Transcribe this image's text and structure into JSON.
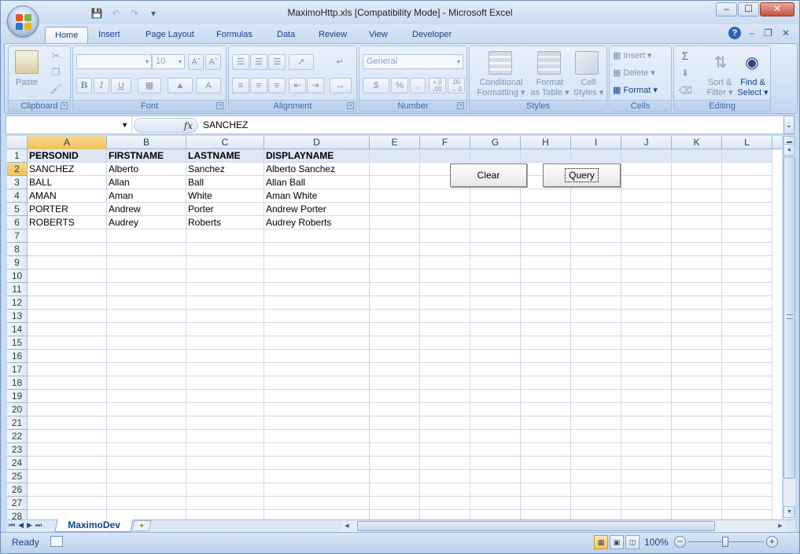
{
  "window": {
    "title": "MaximoHttp.xls  [Compatibility Mode] - Microsoft Excel",
    "min": "–",
    "max": "☐",
    "close": "✕"
  },
  "tabs": [
    "Home",
    "Insert",
    "Page Layout",
    "Formulas",
    "Data",
    "Review",
    "View",
    "Developer"
  ],
  "active_tab": "Home",
  "ribbon": {
    "clipboard": {
      "label": "Clipboard",
      "paste": "Paste"
    },
    "font": {
      "label": "Font",
      "font_name": "",
      "font_size": "10"
    },
    "alignment": {
      "label": "Alignment"
    },
    "number": {
      "label": "Number",
      "format": "General",
      "currency": "$",
      "percent": "%",
      "comma": ",",
      "inc_dec": "+.0\n.00",
      "dec_dec": ".00\n→.0"
    },
    "styles": {
      "label": "Styles",
      "conditional": [
        "Conditional",
        "Formatting ▾"
      ],
      "format_table": [
        "Format",
        "as Table ▾"
      ],
      "cell_styles": [
        "Cell",
        "Styles ▾"
      ]
    },
    "cells": {
      "label": "Cells",
      "insert": "Insert ▾",
      "delete": "Delete ▾",
      "format": "Format ▾"
    },
    "editing": {
      "label": "Editing",
      "sort": [
        "Sort &",
        "Filter ▾"
      ],
      "find": [
        "Find &",
        "Select ▾"
      ]
    }
  },
  "formula_bar": {
    "name_box": "",
    "fx": "fx",
    "content": "SANCHEZ"
  },
  "columns": [
    "A",
    "B",
    "C",
    "D",
    "E",
    "F",
    "G",
    "H",
    "I",
    "J",
    "K",
    "L"
  ],
  "rows": [
    "1",
    "2",
    "3",
    "4",
    "5",
    "6",
    "7",
    "8",
    "9",
    "10",
    "11",
    "12",
    "13",
    "14",
    "15",
    "16",
    "17",
    "18",
    "19",
    "20",
    "21",
    "22",
    "23",
    "24",
    "25",
    "26",
    "27",
    "28"
  ],
  "table": {
    "headers": [
      "PERSONID",
      "FIRSTNAME",
      "LASTNAME",
      "DISPLAYNAME"
    ],
    "data": [
      [
        "SANCHEZ",
        "Alberto",
        "Sanchez",
        "Alberto Sanchez"
      ],
      [
        "BALL",
        "Allan",
        "Ball",
        "Allan Ball"
      ],
      [
        "AMAN",
        "Aman",
        "White",
        "Aman White"
      ],
      [
        "PORTER",
        "Andrew",
        "Porter",
        "Andrew Porter"
      ],
      [
        "ROBERTS",
        "Audrey",
        "Roberts",
        "Audrey Roberts"
      ]
    ]
  },
  "buttons": {
    "clear": "Clear",
    "query": "Query"
  },
  "sheet_tab": "MaximoDev",
  "status": {
    "text": "Ready",
    "zoom": "100%"
  },
  "colors": {
    "ribbon": "#cedff3",
    "selection": "#f1c05a",
    "grid": "#d0d7e5"
  }
}
